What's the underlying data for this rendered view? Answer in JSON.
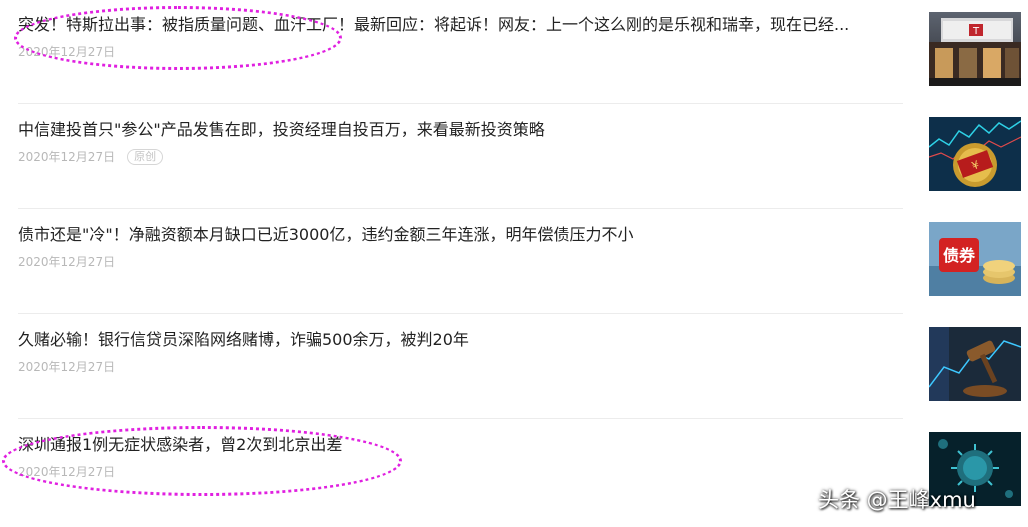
{
  "news": [
    {
      "title": "突发！特斯拉出事：被指质量问题、血汗工厂！最新回应：将起诉！网友：上一个这么刚的是乐视和瑞幸，现在已经...",
      "date": "2020年12月27日",
      "tag": "",
      "thumb_icon": "tesla-store-thumbnail"
    },
    {
      "title": "中信建投首只\"参公\"产品发售在即，投资经理自投百万，来看最新投资策略",
      "date": "2020年12月27日",
      "tag": "原创",
      "thumb_icon": "fund-coins-thumbnail"
    },
    {
      "title": "债市还是\"冷\"！净融资额本月缺口已近3000亿，违约金额三年连涨，明年偿债压力不小",
      "date": "2020年12月27日",
      "tag": "",
      "thumb_icon": "bond-thumbnail",
      "thumb_text": "债券"
    },
    {
      "title": "久赌必输！银行信贷员深陷网络赌博，诈骗500余万，被判20年",
      "date": "2020年12月27日",
      "tag": "",
      "thumb_icon": "gavel-thumbnail"
    },
    {
      "title": "深圳通报1例无症状感染者，曾2次到北京出差",
      "date": "2020年12月27日",
      "tag": "",
      "thumb_icon": "virus-thumbnail"
    }
  ],
  "watermark": "头条 @王峰xmu",
  "colors": {
    "title": "#222222",
    "date": "#b8b8b8",
    "annotation": "#e020e0",
    "divider": "#ececec"
  }
}
